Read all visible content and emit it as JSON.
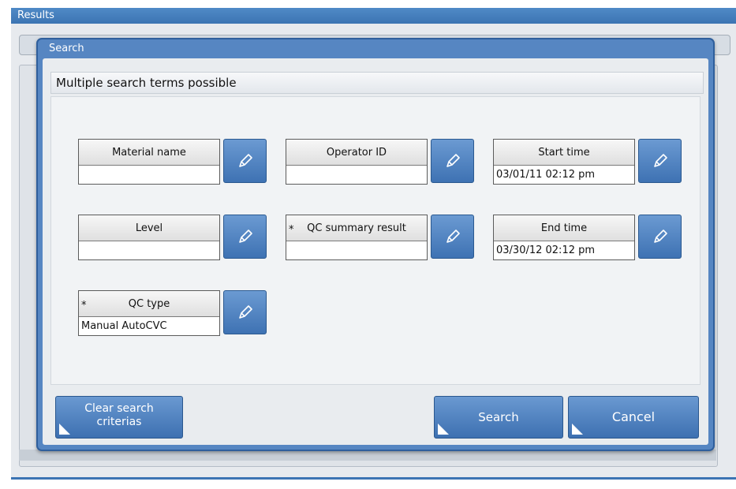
{
  "window": {
    "title": "Results"
  },
  "dialog": {
    "title": "Search",
    "hint": "Multiple search terms possible",
    "fields": [
      {
        "label": "Material name",
        "value": "",
        "required": false
      },
      {
        "label": "Operator ID",
        "value": "",
        "required": false
      },
      {
        "label": "Start time",
        "value": "03/01/11 02:12 pm",
        "required": false
      },
      {
        "label": "Level",
        "value": "",
        "required": false
      },
      {
        "label": "QC summary result",
        "value": "",
        "required": true
      },
      {
        "label": "End time",
        "value": "03/30/12 02:12 pm",
        "required": false
      },
      {
        "label": "QC type",
        "value": "Manual AutoCVC",
        "required": true
      }
    ],
    "required_marker": "*",
    "buttons": {
      "clear": "Clear search criterias",
      "search": "Search",
      "cancel": "Cancel"
    }
  },
  "icons": {
    "edit": "pencil-icon",
    "corner": "corner-indicator"
  },
  "colors": {
    "accent": "#3c74b3",
    "panel": "#e9ecef"
  }
}
